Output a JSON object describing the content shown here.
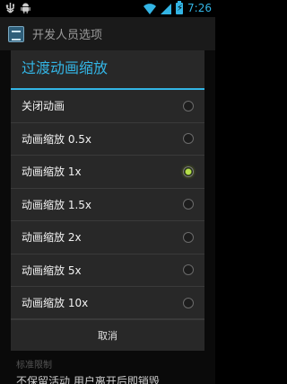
{
  "status_bar": {
    "time": "7:26",
    "left_icons": [
      "usb-debugging-icon",
      "android-icon"
    ],
    "right_icons": [
      "wifi-icon",
      "signal-icon",
      "battery-charging-icon"
    ]
  },
  "action_bar": {
    "title": "开发人员选项",
    "icon": "settings-app-icon"
  },
  "dialog": {
    "title": "过渡动画缩放",
    "options": [
      {
        "label": "关闭动画",
        "checked": false
      },
      {
        "label": "动画缩放 0.5x",
        "checked": false
      },
      {
        "label": "动画缩放 1x",
        "checked": true
      },
      {
        "label": "动画缩放 1.5x",
        "checked": false
      },
      {
        "label": "动画缩放 2x",
        "checked": false
      },
      {
        "label": "动画缩放 5x",
        "checked": false
      },
      {
        "label": "动画缩放 10x",
        "checked": false
      }
    ],
    "cancel_label": "取消"
  },
  "background": {
    "section_caption": "标准限制",
    "partial_item": "不保留活动 用户离开后即销毁"
  },
  "colors": {
    "accent": "#33b5e5",
    "radio_checked": "#99cc00"
  }
}
